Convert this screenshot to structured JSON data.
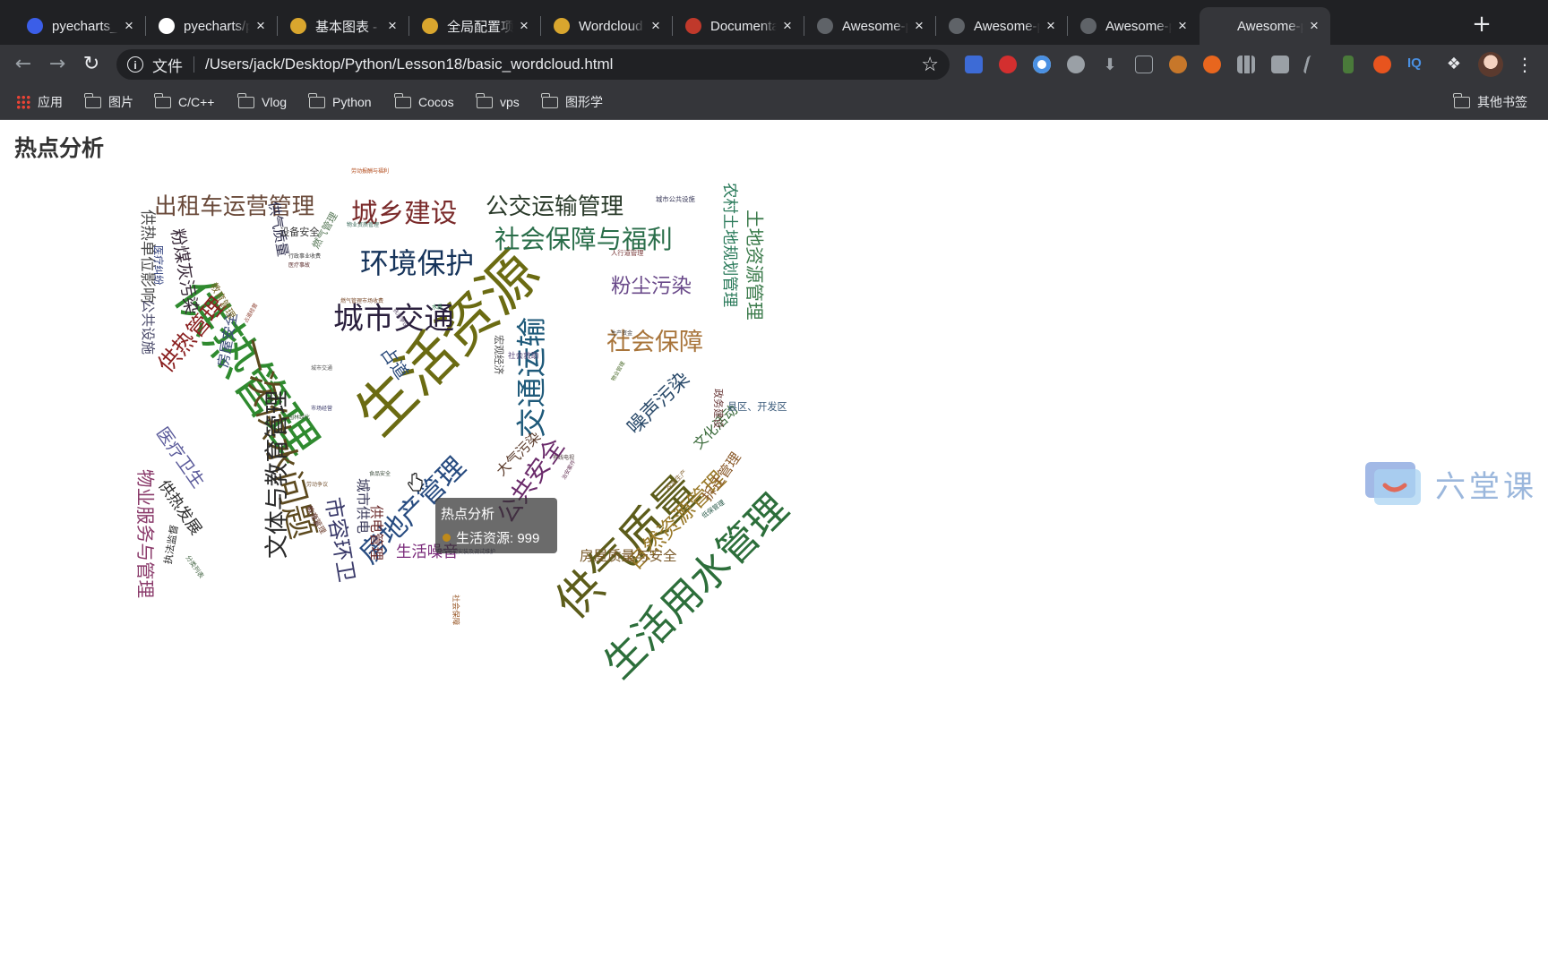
{
  "browser": {
    "tabs": [
      {
        "label": "pyecharts_E",
        "icon": "baidu-icon",
        "color": "#3b5ee8"
      },
      {
        "label": "pyecharts/p",
        "icon": "github-icon",
        "color": "#ffffff"
      },
      {
        "label": "基本图表 - p",
        "icon": "pyecharts-icon",
        "color": "#d9a62e"
      },
      {
        "label": "全局配置项 -",
        "icon": "pyecharts-icon",
        "color": "#d9a62e"
      },
      {
        "label": "Wordcloud -",
        "icon": "pyecharts-icon",
        "color": "#d9a62e"
      },
      {
        "label": "Documentat",
        "icon": "documentation-icon",
        "color": "#c0392b"
      },
      {
        "label": "Awesome-p",
        "icon": "globe-icon",
        "color": "#5f6368"
      },
      {
        "label": "Awesome-p",
        "icon": "globe-icon",
        "color": "#5f6368"
      },
      {
        "label": "Awesome-p",
        "icon": "globe-icon",
        "color": "#5f6368"
      },
      {
        "label": "Awesome-p",
        "icon": "globe-icon",
        "color": "#5f6368"
      }
    ],
    "new_tab": "+",
    "address": {
      "scheme_label": "文件",
      "url": "/Users/jack/Desktop/Python/Lesson18/basic_wordcloud.html"
    },
    "bookmarks": [
      "应用",
      "图片",
      "C/C++",
      "Vlog",
      "Python",
      "Cocos",
      "vps",
      "图形学"
    ],
    "other_bookmarks": "其他书签"
  },
  "page": {
    "title": "热点分析",
    "tooltip": {
      "title": "热点分析",
      "text": "生活资源: 999",
      "dot_color": "#bf8a1a"
    }
  },
  "watermark": {
    "text": "六堂课"
  },
  "chart_data": {
    "type": "wordcloud",
    "series_name": "热点分析",
    "words": [
      {
        "name": "生活资源",
        "value": 999,
        "color": "#6b6b12"
      },
      {
        "name": "供热管理",
        "value": 888,
        "color": "#2f8a2f"
      },
      {
        "name": "供气质量",
        "value": 777,
        "color": "#5c5c1a"
      },
      {
        "name": "生活用水管理",
        "value": 688,
        "color": "#2c6e3a"
      },
      {
        "name": "一次供水问题",
        "value": 588,
        "color": "#5d4a1f"
      },
      {
        "name": "交通运输",
        "value": 516,
        "color": "#1f5a7a"
      },
      {
        "name": "城市交通",
        "value": 515,
        "color": "#2a1f3d"
      },
      {
        "name": "环境保护",
        "value": 483,
        "color": "#15335a"
      },
      {
        "name": "房地产管理",
        "value": 462,
        "color": "#274b80"
      },
      {
        "name": "城乡建设",
        "value": 449,
        "color": "#7a2a2a"
      },
      {
        "name": "社会保障与福利",
        "value": 429,
        "color": "#2a6e4a"
      },
      {
        "name": "社会保障",
        "value": 407,
        "color": "#a8743a"
      },
      {
        "name": "文体与教育管理",
        "value": 406,
        "color": "#2a2a2a"
      },
      {
        "name": "公共安全",
        "value": 406,
        "color": "#6a2a6a"
      },
      {
        "name": "公交运输管理",
        "value": 386,
        "color": "#2a3a2a"
      },
      {
        "name": "出租车运营管理",
        "value": 385,
        "color": "#6a4a3a"
      },
      {
        "name": "供热管理",
        "value": 375,
        "color": "#8a1f1f"
      },
      {
        "name": "市容环卫",
        "value": 355,
        "color": "#3a3a6a"
      },
      {
        "name": "自然资源管理",
        "value": 355,
        "color": "#9a7a2a"
      },
      {
        "name": "粉尘污染",
        "value": 335,
        "color": "#6a4a8a"
      },
      {
        "name": "噪声污染",
        "value": 324,
        "color": "#2a4a6a"
      },
      {
        "name": "土地资源管理",
        "value": 304,
        "color": "#3a7a4a"
      },
      {
        "name": "物业服务与管理",
        "value": 304,
        "color": "#8a3a6a"
      },
      {
        "name": "医疗卫生",
        "value": 284,
        "color": "#5a5a9a"
      },
      {
        "name": "粉煤灰污染",
        "value": 284,
        "color": "#3a2a3a"
      },
      {
        "name": "占道",
        "value": 284,
        "color": "#2a4a7a"
      },
      {
        "name": "供热发展",
        "value": 254,
        "color": "#2a2a2a"
      },
      {
        "name": "农村土地规划管理",
        "value": 254,
        "color": "#2a7a5a"
      },
      {
        "name": "生活噪音",
        "value": 253,
        "color": "#7a2a7a"
      },
      {
        "name": "供热单位影响",
        "value": 253,
        "color": "#4a4a4a"
      },
      {
        "name": "城市供电",
        "value": 223,
        "color": "#3a3a5a"
      },
      {
        "name": "房屋质量与安全",
        "value": 223,
        "color": "#7a5a2a"
      },
      {
        "name": "大气污染",
        "value": 223,
        "color": "#5a3a2a"
      },
      {
        "name": "房屋安全",
        "value": 223,
        "color": "#3a4a7a"
      },
      {
        "name": "文化活动",
        "value": 223,
        "color": "#3a6a3a"
      },
      {
        "name": "拆迁管理",
        "value": 223,
        "color": "#8a5a2a"
      },
      {
        "name": "公共设施",
        "value": 223,
        "color": "#4a4a6a"
      },
      {
        "name": "供气质量",
        "value": 223,
        "color": "#2a2a4a"
      },
      {
        "name": "供电管理",
        "value": 223,
        "color": "#6a2a2a"
      },
      {
        "name": "燃气管理",
        "value": 152,
        "color": "#5a7a5a"
      },
      {
        "name": "教育管理",
        "value": 152,
        "color": "#7a6a2a"
      },
      {
        "name": "医疗纠纷",
        "value": 152,
        "color": "#2a3a7a"
      },
      {
        "name": "执法监督",
        "value": 152,
        "color": "#2a2a2a"
      },
      {
        "name": "设备安全",
        "value": 152,
        "color": "#3a3a3a"
      },
      {
        "name": "政务建设",
        "value": 152,
        "color": "#6a3a3a"
      },
      {
        "name": "县区、开发区",
        "value": 152,
        "color": "#3a5a7a"
      },
      {
        "name": "宏观经济",
        "value": 152,
        "color": "#4a4a4a"
      },
      {
        "name": "教育管理",
        "value": 112,
        "color": "#6a3a2a"
      },
      {
        "name": "社会救助",
        "value": 112,
        "color": "#5a4a7a"
      },
      {
        "name": "社会保障",
        "value": 112,
        "color": "#9a5a2a"
      },
      {
        "name": "城市公共设施",
        "value": 92,
        "color": "#3a3a5a"
      },
      {
        "name": "人行道管理",
        "value": 92,
        "color": "#7a3a3a"
      },
      {
        "name": "分类列表",
        "value": 92,
        "color": "#4a6a4a"
      },
      {
        "name": "低保管理",
        "value": 92,
        "color": "#2a5a4a"
      },
      {
        "name": "农业生产",
        "value": 92,
        "color": "#8a6a3a"
      },
      {
        "name": "劳动报酬与福利",
        "value": 71,
        "color": "#b24a1a"
      },
      {
        "name": "物业管理",
        "value": 71,
        "color": "#4a6a2a"
      },
      {
        "name": "水质",
        "value": 71,
        "color": "#2a7a4a"
      },
      {
        "name": "生产资金",
        "value": 71,
        "color": "#3a3a3a"
      },
      {
        "name": "执法争议",
        "value": 71,
        "color": "#5a4a6a"
      },
      {
        "name": "燃气管理市场收费",
        "value": 71,
        "color": "#7a4a2a"
      },
      {
        "name": "占道经营",
        "value": 71,
        "color": "#8a3a2a"
      },
      {
        "name": "园林绿化",
        "value": 71,
        "color": "#3a5a3a"
      },
      {
        "name": "城市交通",
        "value": 71,
        "color": "#5a5a5a"
      },
      {
        "name": "市场经营",
        "value": 71,
        "color": "#3a3a6a"
      },
      {
        "name": "物业资质管理",
        "value": 71,
        "color": "#3a6a5a"
      },
      {
        "name": "治安案件",
        "value": 71,
        "color": "#6a3a5a"
      },
      {
        "name": "有线电视",
        "value": 71,
        "color": "#4a3a3a"
      },
      {
        "name": "劳动争议",
        "value": 71,
        "color": "#7a5a3a"
      },
      {
        "name": "农村低保",
        "value": 71,
        "color": "#5a3a3a"
      },
      {
        "name": "食品安全",
        "value": 71,
        "color": "#3a4a3a"
      },
      {
        "name": "行政事业收费",
        "value": 71,
        "color": "#3a3a3a"
      },
      {
        "name": "医疗事故",
        "value": 71,
        "color": "#5a2a2a"
      },
      {
        "name": "有线电视安装及调试维护",
        "value": 71,
        "color": "#4a4a6a"
      }
    ]
  }
}
